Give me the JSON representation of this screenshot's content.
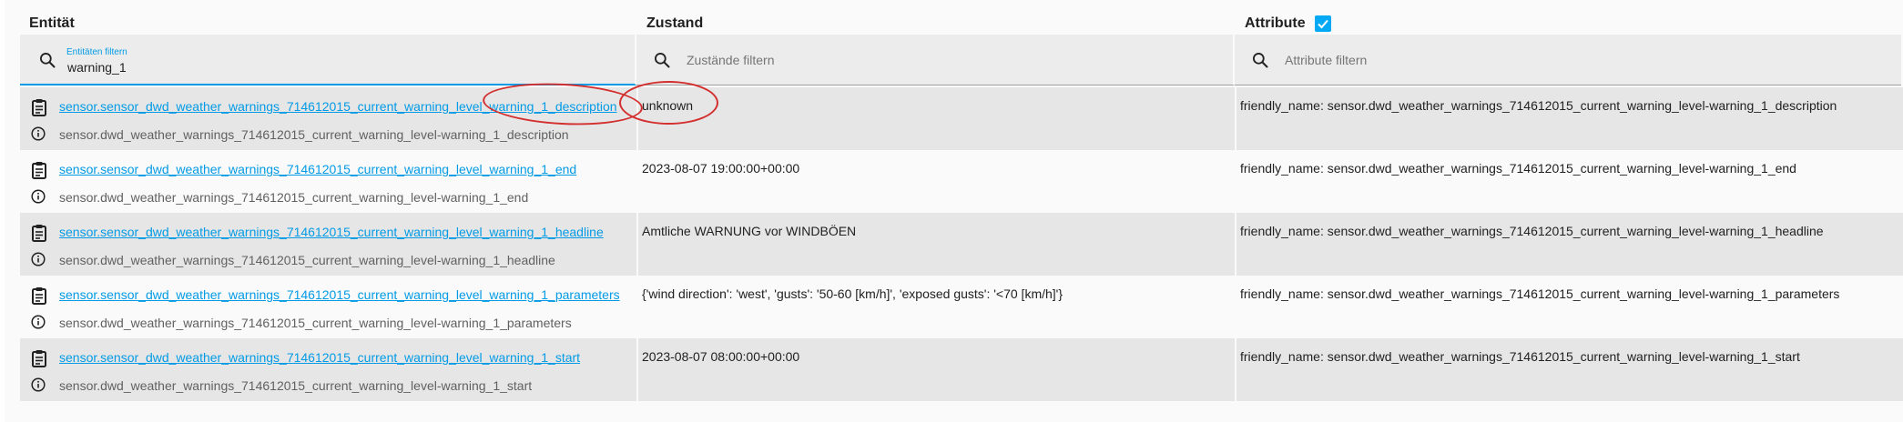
{
  "columns": {
    "entity": "Entität",
    "state": "Zustand",
    "attributes": "Attribute",
    "attributes_checked": true
  },
  "filters": {
    "entity": {
      "label": "Entitäten filtern",
      "value": "warning_1"
    },
    "state": {
      "placeholder": "Zustände filtern",
      "value": ""
    },
    "attributes": {
      "placeholder": "Attribute filtern",
      "value": ""
    }
  },
  "rows": [
    {
      "entity_id": "sensor.sensor_dwd_weather_warnings_714612015_current_warning_level_warning_1_description",
      "friendly": "sensor.dwd_weather_warnings_714612015_current_warning_level-warning_1_description",
      "state": "unknown",
      "attributes": "friendly_name: sensor.dwd_weather_warnings_714612015_current_warning_level-warning_1_description"
    },
    {
      "entity_id": "sensor.sensor_dwd_weather_warnings_714612015_current_warning_level_warning_1_end",
      "friendly": "sensor.dwd_weather_warnings_714612015_current_warning_level-warning_1_end",
      "state": "2023-08-07 19:00:00+00:00",
      "attributes": "friendly_name: sensor.dwd_weather_warnings_714612015_current_warning_level-warning_1_end"
    },
    {
      "entity_id": "sensor.sensor_dwd_weather_warnings_714612015_current_warning_level_warning_1_headline",
      "friendly": "sensor.dwd_weather_warnings_714612015_current_warning_level-warning_1_headline",
      "state": "Amtliche WARNUNG vor WINDBÖEN",
      "attributes": "friendly_name: sensor.dwd_weather_warnings_714612015_current_warning_level-warning_1_headline"
    },
    {
      "entity_id": "sensor.sensor_dwd_weather_warnings_714612015_current_warning_level_warning_1_parameters",
      "friendly": "sensor.dwd_weather_warnings_714612015_current_warning_level-warning_1_parameters",
      "state": "{'wind direction': 'west', 'gusts': '50-60 [km/h]', 'exposed gusts': '<70 [km/h]'}",
      "attributes": "friendly_name: sensor.dwd_weather_warnings_714612015_current_warning_level-warning_1_parameters"
    },
    {
      "entity_id": "sensor.sensor_dwd_weather_warnings_714612015_current_warning_level_warning_1_start",
      "friendly": "sensor.dwd_weather_warnings_714612015_current_warning_level-warning_1_start",
      "state": "2023-08-07 08:00:00+00:00",
      "attributes": "friendly_name: sensor.dwd_weather_warnings_714612015_current_warning_level-warning_1_start"
    }
  ],
  "icons": {
    "filter": "search-icon",
    "copy": "clipboard-icon",
    "info": "info-icon",
    "checkbox": "checkbox-checked-icon"
  },
  "colors": {
    "accent": "#039be5",
    "checkbox": "#03a9f4",
    "annotation": "#d32f2f",
    "row_shaded": "#e6e6e6",
    "row_plain": "#fafafa"
  }
}
